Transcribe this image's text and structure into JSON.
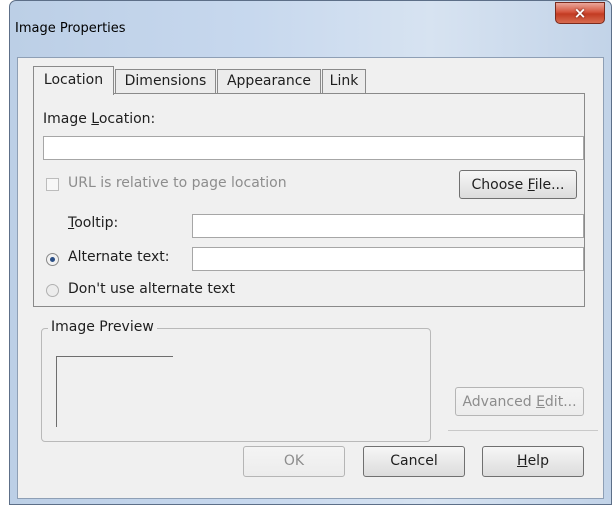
{
  "window": {
    "title": "Image Properties",
    "close_glyph": "×"
  },
  "tabs": [
    {
      "label": "Location",
      "active": true
    },
    {
      "label": "Dimensions",
      "active": false
    },
    {
      "label": "Appearance",
      "active": false
    },
    {
      "label": "Link",
      "active": false
    }
  ],
  "location": {
    "image_location_pre": "Image ",
    "image_location_key": "L",
    "image_location_post": "ocation:",
    "image_location_value": "",
    "url_relative_label": "URL is relative to page location",
    "url_relative_checked": false,
    "choose_file_pre": "Choose ",
    "choose_file_key": "F",
    "choose_file_post": "ile...",
    "tooltip_key": "T",
    "tooltip_post": "ooltip:",
    "tooltip_value": "",
    "alt_text_label": "Alternate text:",
    "alt_text_value": "",
    "no_alt_label": "Don't use alternate text",
    "alt_selected": "alternate"
  },
  "preview": {
    "legend": "Image Preview"
  },
  "buttons": {
    "advanced_pre": "Advanced ",
    "advanced_key": "E",
    "advanced_post": "dit...",
    "ok": "OK",
    "cancel": "Cancel",
    "help_key": "H",
    "help_post": "elp"
  },
  "colors": {
    "title_gradient": "#c7d8ee",
    "close_red": "#c23b22",
    "dialog_bg": "#f0f0f0"
  }
}
